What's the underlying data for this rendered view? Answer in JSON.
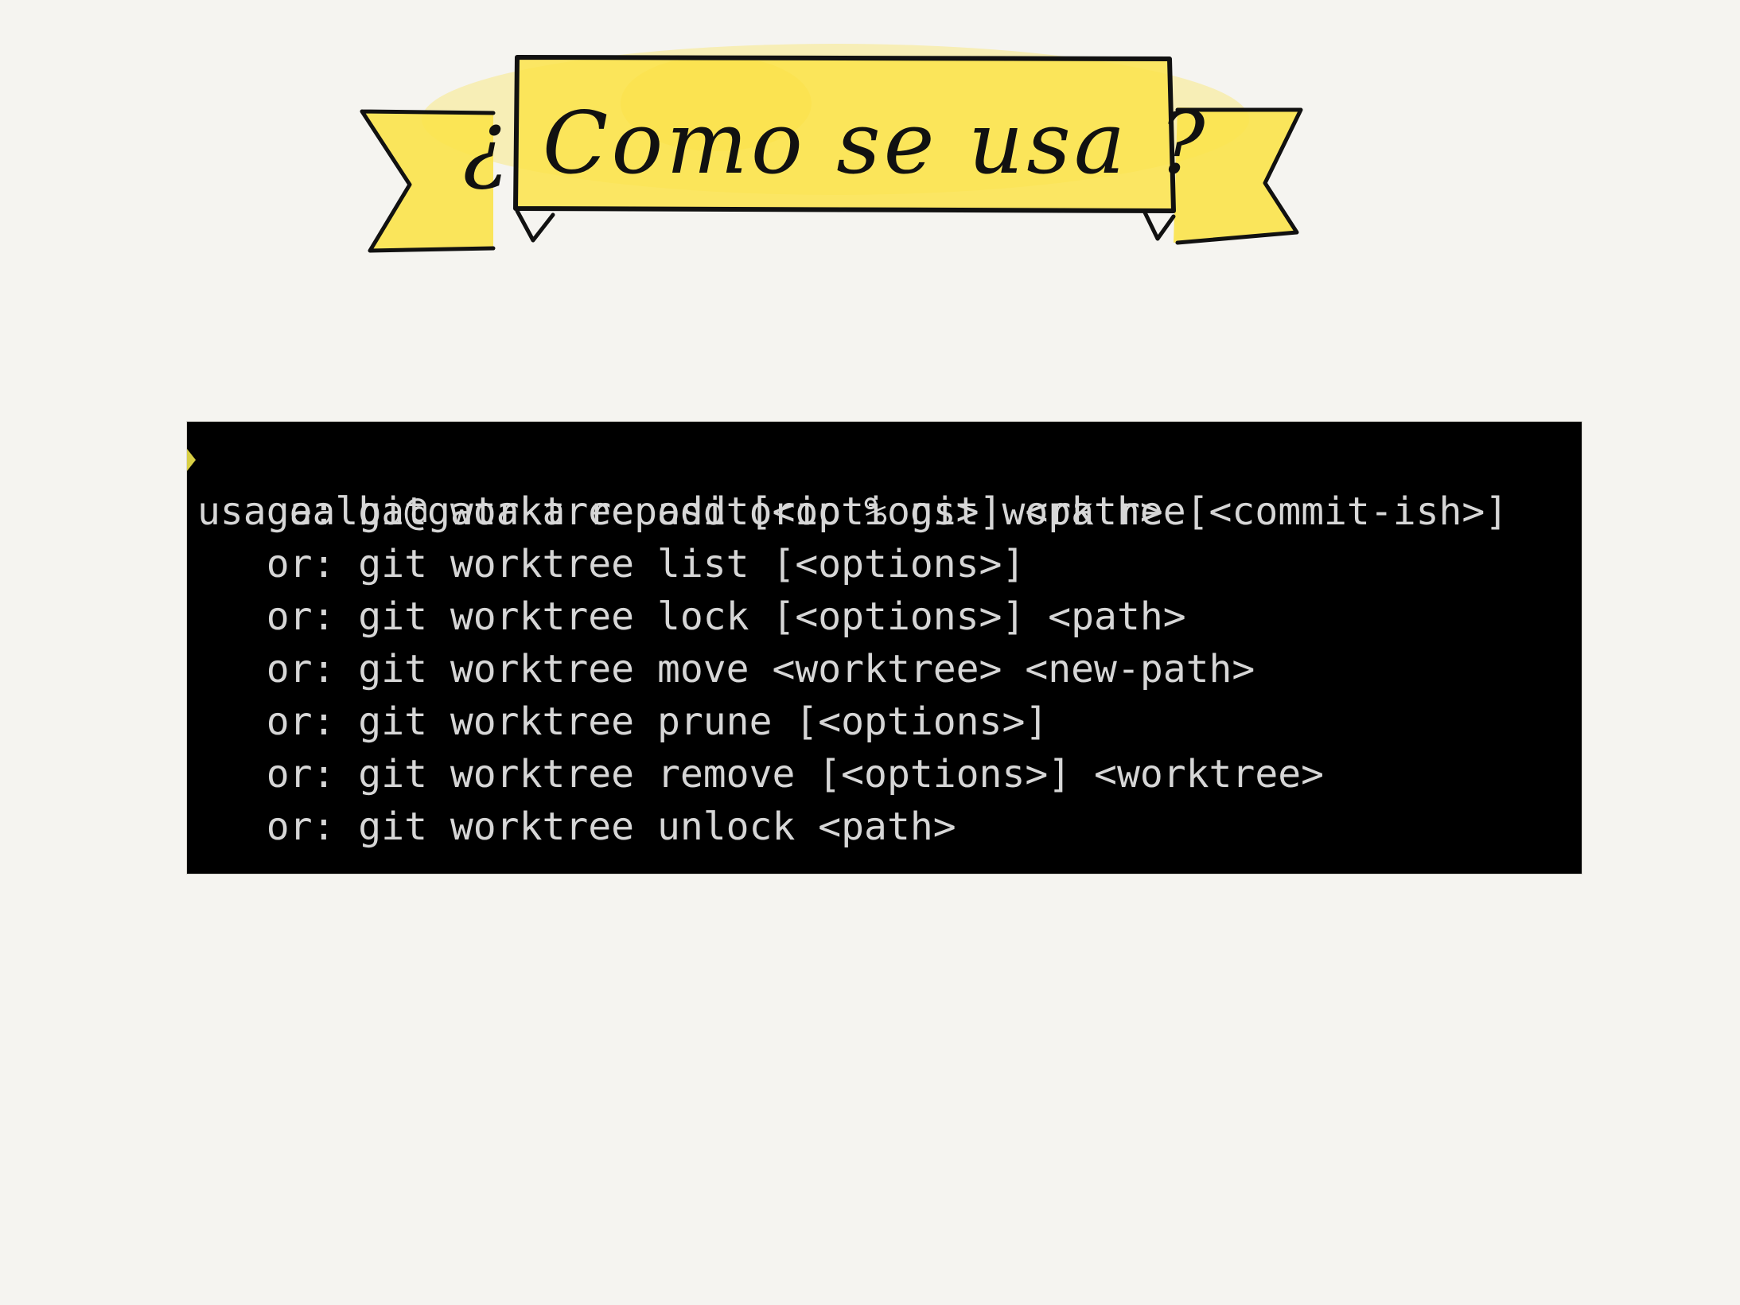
{
  "slide": {
    "title": "¿ Como se usa ?",
    "colors": {
      "background": "#f5f4f0",
      "banner_fill": "#fbe34a",
      "terminal_bg": "#000000",
      "terminal_text": "#d6d6d6",
      "prompt_marker": "#d8cf45"
    }
  },
  "terminal": {
    "prompt_marker_icon": "prompt-marker-icon",
    "lines": [
      "aalba@gataka repositorio % git worktree",
      "usage: git worktree add [<options>] <path> [<commit-ish>]",
      "   or: git worktree list [<options>]",
      "   or: git worktree lock [<options>] <path>",
      "   or: git worktree move <worktree> <new-path>",
      "   or: git worktree prune [<options>]",
      "   or: git worktree remove [<options>] <worktree>",
      "   or: git worktree unlock <path>"
    ]
  }
}
